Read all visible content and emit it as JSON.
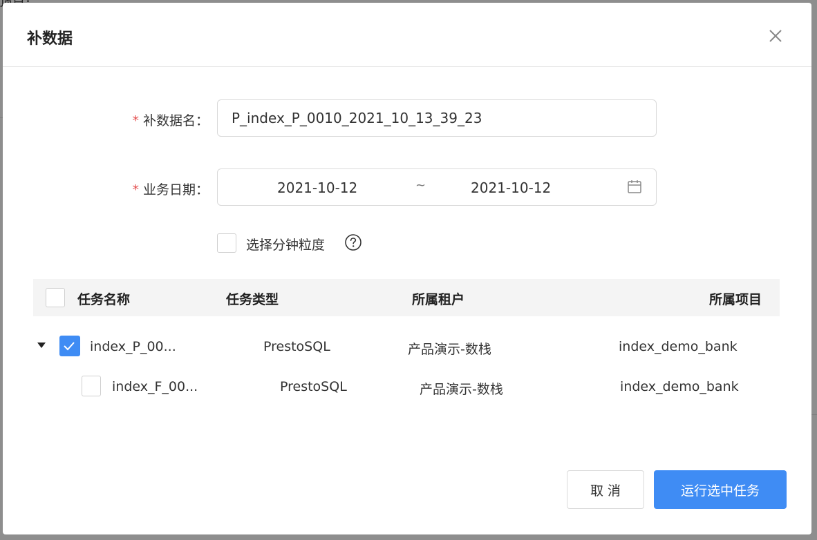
{
  "background": {
    "fragment_text": "项目："
  },
  "modal": {
    "title": "补数据",
    "close_icon": "close-icon"
  },
  "form": {
    "name": {
      "required_mark": "*",
      "label": "补数据名：",
      "value": "P_index_P_0010_2021_10_13_39_23"
    },
    "date": {
      "required_mark": "*",
      "label": "业务日期：",
      "start": "2021-10-12",
      "separator": "~",
      "end": "2021-10-12",
      "icon": "calendar-icon"
    },
    "minute": {
      "label": "选择分钟粒度",
      "checked": false,
      "icon": "question-circle-icon"
    }
  },
  "table": {
    "headers": [
      "任务名称",
      "任务类型",
      "所属租户",
      "所属项目"
    ],
    "rows": [
      {
        "name": "index_P_00...",
        "type": "PrestoSQL",
        "tenant": "产品演示-数栈",
        "project": "index_demo_bank",
        "checked": true,
        "expanded": true
      },
      {
        "name": "index_F_00...",
        "type": "PrestoSQL",
        "tenant": "产品演示-数栈",
        "project": "index_demo_bank",
        "checked": false
      }
    ]
  },
  "footer": {
    "cancel_label": "取 消",
    "run_label": "运行选中任务"
  },
  "colors": {
    "primary": "#3f8cf4",
    "required": "#e34d4d",
    "table_header_bg": "#f4f4f4"
  }
}
